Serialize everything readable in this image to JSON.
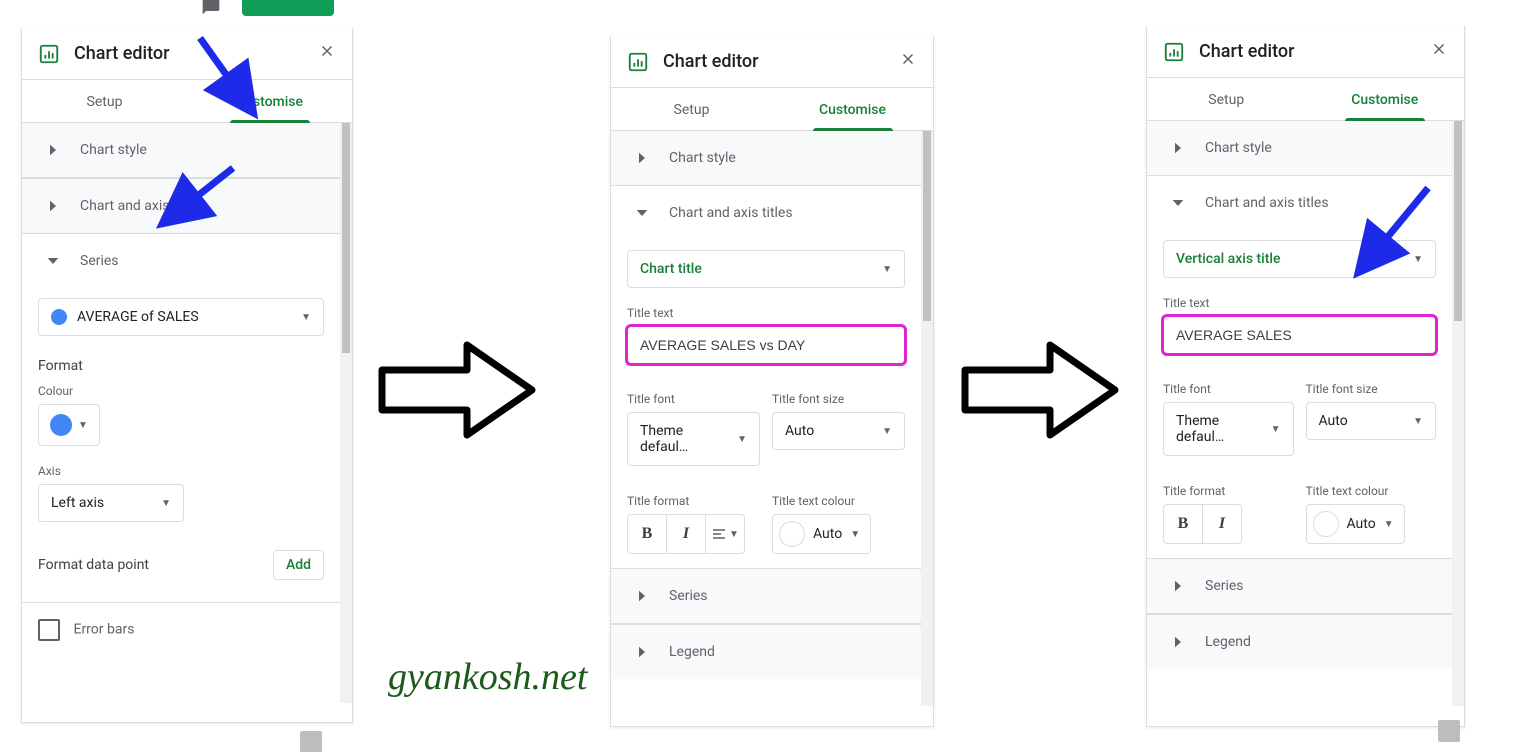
{
  "common": {
    "editor_title": "Chart editor",
    "tabs": {
      "setup": "Setup",
      "customise": "Customise"
    },
    "sections": {
      "chart_style": "Chart style",
      "chart_axis_titles": "Chart and axis titles",
      "series": "Series",
      "legend": "Legend"
    },
    "labels": {
      "title_text": "Title text",
      "title_font": "Title font",
      "title_font_size": "Title font size",
      "title_format": "Title format",
      "title_text_colour": "Title text colour",
      "colour": "Colour",
      "axis": "Axis",
      "format": "Format",
      "format_data_point": "Format data point",
      "error_bars": "Error bars"
    },
    "values": {
      "theme_default": "Theme defaul…",
      "auto": "Auto",
      "left_axis": "Left axis",
      "add": "Add"
    }
  },
  "panel1": {
    "series_selected": "AVERAGE of SALES",
    "series_colour": "#4285f4"
  },
  "panel2": {
    "title_type": "Chart title",
    "title_text": "AVERAGE SALES vs DAY"
  },
  "panel3": {
    "title_type": "Vertical axis title",
    "title_text": "AVERAGE SALES"
  },
  "watermark": "gyankosh.net"
}
